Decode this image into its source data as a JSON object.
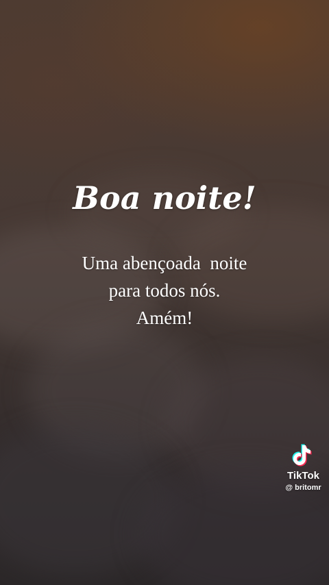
{
  "greeting": {
    "title": "Boa noite!",
    "lines": [
      "Uma abençoada  noite",
      "para todos nós.",
      "Amém!"
    ]
  },
  "watermark": {
    "icon": "tiktok-icon",
    "brand": "TikTok",
    "handle": "@ britomr"
  },
  "colors": {
    "text": "#ffffff",
    "sky_top": "#4d3b31",
    "sky_bottom": "#2b2728",
    "glow": "#784620",
    "tiktok_cyan": "#25f4ee",
    "tiktok_red": "#fe2c55"
  }
}
